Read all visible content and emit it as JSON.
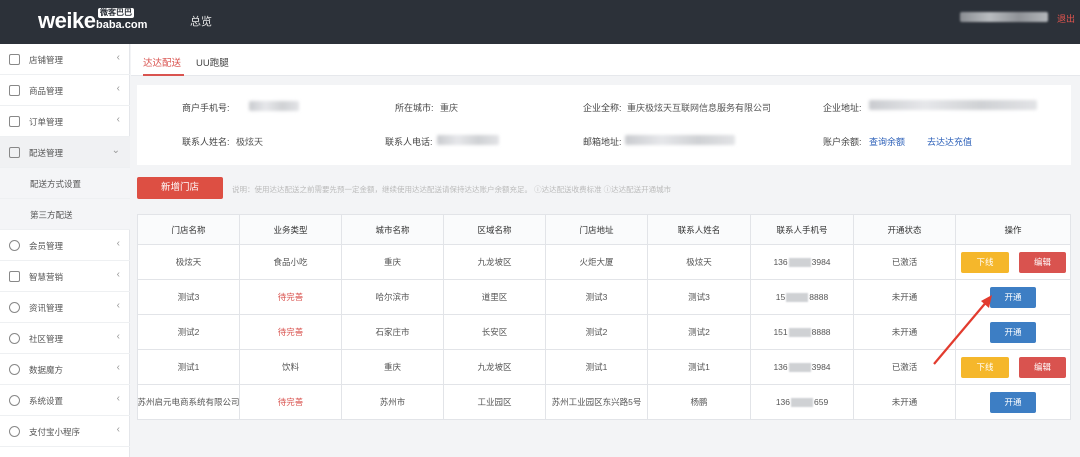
{
  "header": {
    "logo_text": "weike",
    "logo_domain": "baba.com",
    "logo_cn": "微客巴巴",
    "nav_overview": "总览",
    "logout": "退出"
  },
  "sidebar": {
    "items": [
      {
        "label": "店铺管理",
        "icon": "store-icon",
        "arrow": "‹"
      },
      {
        "label": "商品管理",
        "icon": "goods-icon",
        "arrow": "‹"
      },
      {
        "label": "订单管理",
        "icon": "order-icon",
        "arrow": "‹"
      },
      {
        "label": "配送管理",
        "icon": "truck-icon",
        "arrow": "⌄"
      },
      {
        "label": "配送方式设置",
        "sub": true
      },
      {
        "label": "第三方配送",
        "sub": true
      },
      {
        "label": "会员管理",
        "icon": "member-icon",
        "arrow": "‹"
      },
      {
        "label": "智慧营销",
        "icon": "marketing-icon",
        "arrow": "‹"
      },
      {
        "label": "资讯管理",
        "icon": "globe-icon",
        "arrow": "‹"
      },
      {
        "label": "社区管理",
        "icon": "community-icon",
        "arrow": "‹"
      },
      {
        "label": "数据魔方",
        "icon": "chart-icon",
        "arrow": "‹"
      },
      {
        "label": "系统设置",
        "icon": "settings-icon",
        "arrow": "‹"
      },
      {
        "label": "支付宝小程序",
        "icon": "alipay-icon",
        "arrow": "‹"
      }
    ]
  },
  "tabs": [
    {
      "label": "达达配送",
      "active": true
    },
    {
      "label": "UU跑腿",
      "active": false
    }
  ],
  "info": {
    "merchant_phone_label": "商户手机号:",
    "city_label": "所在城市:",
    "city_value": "重庆",
    "company_label": "企业全称:",
    "company_value": "重庆极炫天互联网信息服务有限公司",
    "address_label": "企业地址:",
    "contact_label": "联系人姓名:",
    "contact_value": "极炫天",
    "contact_phone_label": "联系人电话:",
    "email_label": "邮箱地址:",
    "balance_label": "账户余额:",
    "balance_link": "查询余额",
    "recharge_link": "去达达充值"
  },
  "actions": {
    "add_store": "新增门店",
    "note": "说明：使用达达配送之前需要先预一定金额，继续使用达达配送请保持达达账户余额充足。 ⓘ达达配送收费标准  ⓘ达达配送开通城市"
  },
  "table": {
    "headers": [
      "门店名称",
      "业务类型",
      "城市名称",
      "区域名称",
      "门店地址",
      "联系人姓名",
      "联系人手机号",
      "开通状态",
      "操作"
    ],
    "rows": [
      {
        "store": "极炫天",
        "type": "食品小吃",
        "type_pending": false,
        "city": "重庆",
        "area": "九龙坡区",
        "address": "火炬大厦",
        "contact": "极炫天",
        "phone_pre": "136",
        "phone_post": "3984",
        "status": "已激活",
        "actions": [
          "下线",
          "编辑"
        ]
      },
      {
        "store": "测试3",
        "type": "待完善",
        "type_pending": true,
        "city": "哈尔滨市",
        "area": "道里区",
        "address": "测试3",
        "contact": "测试3",
        "phone_pre": "15",
        "phone_post": "8888",
        "status": "未开通",
        "actions": [
          "开通"
        ]
      },
      {
        "store": "测试2",
        "type": "待完善",
        "type_pending": true,
        "city": "石家庄市",
        "area": "长安区",
        "address": "测试2",
        "contact": "测试2",
        "phone_pre": "151",
        "phone_post": "8888",
        "status": "未开通",
        "actions": [
          "开通"
        ]
      },
      {
        "store": "测试1",
        "type": "饮料",
        "type_pending": false,
        "city": "重庆",
        "area": "九龙坡区",
        "address": "测试1",
        "contact": "测试1",
        "phone_pre": "136",
        "phone_post": "3984",
        "status": "已激活",
        "actions": [
          "下线",
          "编辑"
        ]
      },
      {
        "store": "苏州启元电商系统有限公司",
        "type": "待完善",
        "type_pending": true,
        "city": "苏州市",
        "area": "工业园区",
        "address": "苏州工业园区东兴路5号",
        "contact": "杨鹏",
        "phone_pre": "136",
        "phone_post": "659",
        "status": "未开通",
        "actions": [
          "开通"
        ]
      }
    ]
  },
  "colors": {
    "topbar": "#2c3139",
    "accent_red": "#d9534f",
    "btn_yellow": "#f5b72b",
    "btn_blue": "#3d7ec4",
    "link_blue": "#2b5fb8"
  }
}
